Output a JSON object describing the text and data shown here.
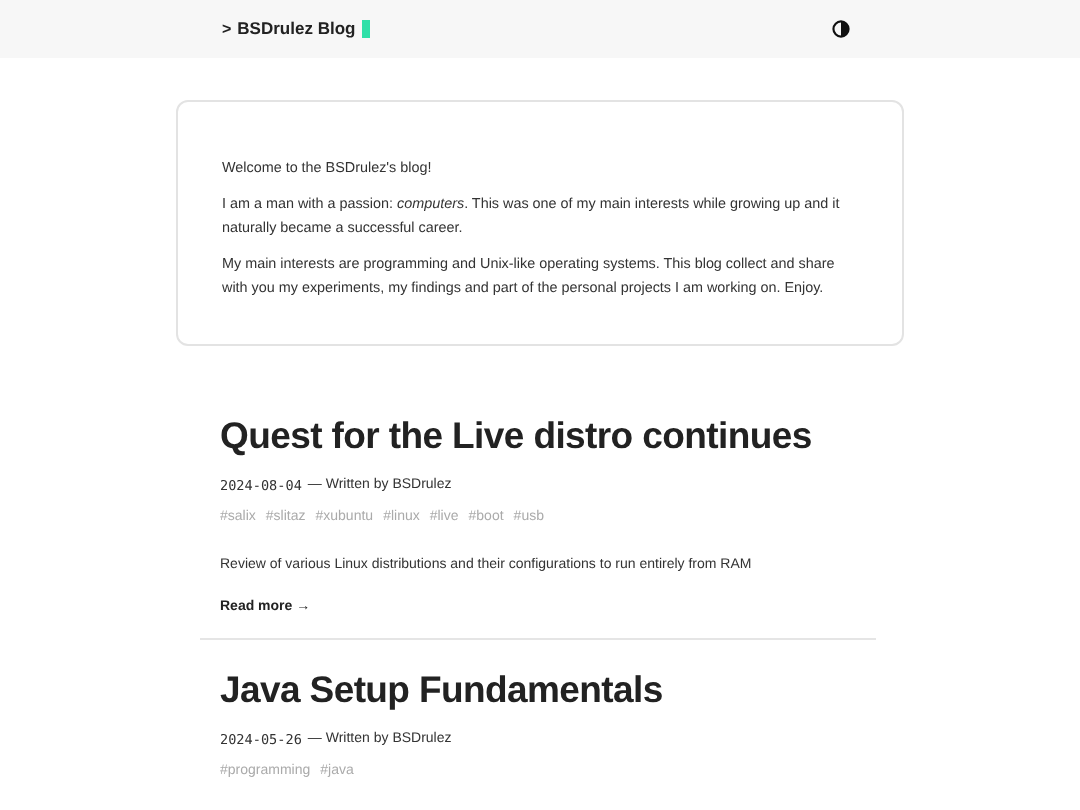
{
  "header": {
    "prompt": ">",
    "title": "BSDrulez Blog",
    "cursor": true
  },
  "intro": [
    "Welcome to the BSDrulez's blog!",
    "I am a man with a passion: *computers*. This was one of my main interests while growing up and it naturally became a successful career.",
    "My main interests are programming and Unix-like operating systems. This blog collect and share with you my experiments, my findings and part of the personal projects I am working on. Enjoy."
  ],
  "posts": [
    {
      "title": "Quest for the Live distro continues",
      "date": "2024-08-04",
      "byline": "— Written by BSDrulez",
      "tags": [
        "#salix",
        "#slitaz",
        "#xubuntu",
        "#linux",
        "#live",
        "#boot",
        "#usb"
      ],
      "summary": "Review of various Linux distributions and their configurations to run entirely from RAM",
      "read_more": "Read more →"
    },
    {
      "title": "Java Setup Fundamentals",
      "date": "2024-05-26",
      "byline": "— Written by BSDrulez",
      "tags": [
        "#programming",
        "#java"
      ]
    }
  ]
}
